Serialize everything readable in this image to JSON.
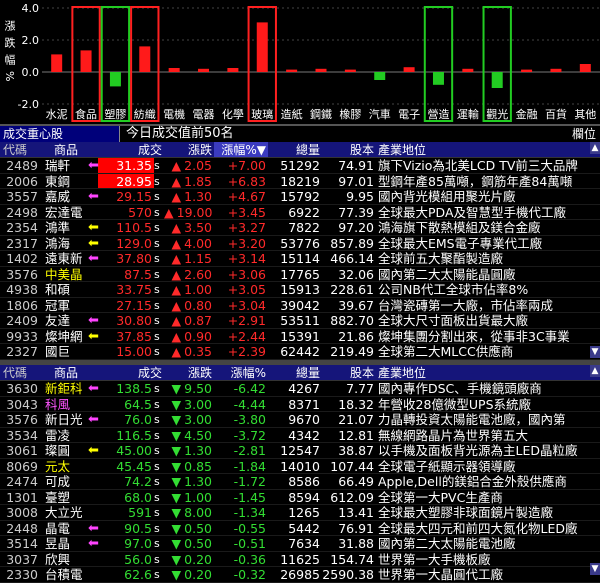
{
  "chart_data": {
    "type": "bar",
    "ylabel": "漲跌幅%",
    "ylim": [
      -2.0,
      4.0
    ],
    "yticks": [
      "4.0",
      "2.0",
      "0.0",
      "-2.0"
    ],
    "categories": [
      "水泥",
      "食品",
      "塑膠",
      "紡織",
      "電機",
      "電器",
      "化學",
      "玻璃",
      "造紙",
      "鋼鐵",
      "橡膠",
      "汽車",
      "電子",
      "營造",
      "運輸",
      "觀光",
      "金融",
      "百貨",
      "其他"
    ],
    "values": [
      1.1,
      1.35,
      -0.9,
      1.6,
      0.25,
      0.2,
      0.25,
      3.1,
      0.15,
      0.2,
      0.15,
      -0.5,
      0.3,
      -0.8,
      0.2,
      -1.0,
      0.15,
      0.2,
      0.5
    ],
    "boxed": {
      "食品": "red",
      "紡織": "red",
      "玻璃": "red",
      "塑膠": "green",
      "營造": "green",
      "觀光": "green"
    }
  },
  "title_bar": {
    "tab_label": "成交重心股",
    "title": "今日成交值前50名",
    "right_label": "欄位"
  },
  "header": {
    "code": "代碼",
    "name": "商品",
    "price": "成交",
    "change": "漲跌",
    "pct": "漲幅%",
    "vol": "總量",
    "cap": "股本",
    "desc": "產業地位"
  },
  "top_rows": [
    {
      "code": "2489",
      "name": "瑞軒",
      "price": "31.35",
      "dir": "up",
      "chg": "2.05",
      "pct": "+7.00",
      "vol": "51292",
      "cap": "74.91",
      "desc": "旗下Vizio為北美LCD TV前三大品牌",
      "hl": true,
      "mark": "arrow-mag"
    },
    {
      "code": "2006",
      "name": "東鋼",
      "price": "28.95",
      "dir": "up",
      "chg": "1.85",
      "pct": "+6.83",
      "vol": "18219",
      "cap": "97.01",
      "desc": "型鋼年產85萬噸，鋼筋年產84萬噸",
      "hl": true,
      "mark": ""
    },
    {
      "code": "3557",
      "name": "嘉威",
      "price": "29.15",
      "dir": "up",
      "chg": "1.30",
      "pct": "+4.67",
      "vol": "15792",
      "cap": "9.95",
      "desc": "國內背光模組用聚光片廠",
      "hl": false,
      "mark": "arrow-mag"
    },
    {
      "code": "2498",
      "name": "宏達電",
      "price": "570",
      "dir": "up",
      "chg": "19.00",
      "pct": "+3.45",
      "vol": "6922",
      "cap": "77.39",
      "desc": "全球最大PDA及智慧型手機代工廠",
      "hl": false,
      "mark": ""
    },
    {
      "code": "2354",
      "name": "鴻準",
      "price": "110.5",
      "dir": "up",
      "chg": "3.50",
      "pct": "+3.27",
      "vol": "7822",
      "cap": "97.20",
      "desc": "鴻海旗下散熱模組及鎂合金廠",
      "hl": false,
      "mark": "arrow-yel"
    },
    {
      "code": "2317",
      "name": "鴻海",
      "price": "129.0",
      "dir": "up",
      "chg": "4.00",
      "pct": "+3.20",
      "vol": "53776",
      "cap": "857.89",
      "desc": "全球最大EMS電子專業代工廠",
      "hl": false,
      "mark": "arrow-yel"
    },
    {
      "code": "1402",
      "name": "遠東新",
      "price": "37.80",
      "dir": "up",
      "chg": "1.15",
      "pct": "+3.14",
      "vol": "15114",
      "cap": "466.14",
      "desc": "全球前五大聚酯製造廠",
      "hl": false,
      "mark": "arrow-mag"
    },
    {
      "code": "3576",
      "name": "中美晶",
      "price": "87.5",
      "dir": "up",
      "chg": "2.60",
      "pct": "+3.06",
      "vol": "17765",
      "cap": "32.06",
      "desc": "國內第二大太陽能晶圓廠",
      "hl": false,
      "mark": "",
      "nameColor": "y"
    },
    {
      "code": "4938",
      "name": "和碩",
      "price": "33.75",
      "dir": "up",
      "chg": "1.00",
      "pct": "+3.05",
      "vol": "15913",
      "cap": "228.61",
      "desc": "公司NB代工全球市佔率8%",
      "hl": false,
      "mark": ""
    },
    {
      "code": "1806",
      "name": "冠軍",
      "price": "27.15",
      "dir": "up",
      "chg": "0.80",
      "pct": "+3.04",
      "vol": "39042",
      "cap": "39.67",
      "desc": "台灣瓷磚第一大廠，市佔率兩成",
      "hl": false,
      "mark": ""
    },
    {
      "code": "2409",
      "name": "友達",
      "price": "30.80",
      "dir": "up",
      "chg": "0.87",
      "pct": "+2.91",
      "vol": "53511",
      "cap": "882.70",
      "desc": "全球大尺寸面板出貨最大廠",
      "hl": false,
      "mark": "arrow-mag"
    },
    {
      "code": "9933",
      "name": "燦坤網",
      "price": "37.85",
      "dir": "up",
      "chg": "0.90",
      "pct": "+2.44",
      "vol": "15391",
      "cap": "21.86",
      "desc": "燦坤集團分割出來，從事非3C事業",
      "hl": false,
      "mark": "arrow-yel"
    },
    {
      "code": "2327",
      "name": "國巨",
      "price": "15.00",
      "dir": "up",
      "chg": "0.35",
      "pct": "+2.39",
      "vol": "62442",
      "cap": "219.49",
      "desc": "全球第二大MLCC供應商",
      "hl": false,
      "mark": ""
    }
  ],
  "bottom_rows": [
    {
      "code": "3630",
      "name": "新鉅科",
      "price": "138.5",
      "dir": "down",
      "chg": "9.50",
      "pct": "-6.42",
      "vol": "4267",
      "cap": "7.77",
      "desc": "國內專作DSC、手機鏡頭廠商",
      "mark": "arrow-mag",
      "nameColor": "y"
    },
    {
      "code": "3043",
      "name": "科風",
      "price": "64.5",
      "dir": "down",
      "chg": "3.00",
      "pct": "-4.44",
      "vol": "8371",
      "cap": "18.32",
      "desc": "年營收28億微型UPS系統廠",
      "mark": "",
      "nameColor": "mag"
    },
    {
      "code": "3576",
      "name": "新日光",
      "price": "76.0",
      "dir": "down",
      "chg": "3.00",
      "pct": "-3.80",
      "vol": "9670",
      "cap": "21.07",
      "desc": "力晶轉投資太陽能電池廠，國內第",
      "mark": "arrow-mag"
    },
    {
      "code": "3534",
      "name": "雷凌",
      "price": "116.5",
      "dir": "down",
      "chg": "4.50",
      "pct": "-3.72",
      "vol": "4342",
      "cap": "12.81",
      "desc": "無線網路晶片為世界第五大",
      "mark": ""
    },
    {
      "code": "3061",
      "name": "璨圓",
      "price": "45.00",
      "dir": "down",
      "chg": "1.30",
      "pct": "-2.81",
      "vol": "12547",
      "cap": "38.87",
      "desc": "以手機及面板背光源為主LED晶粒廠",
      "mark": "arrow-yel"
    },
    {
      "code": "8069",
      "name": "元太",
      "price": "45.45",
      "dir": "down",
      "chg": "0.85",
      "pct": "-1.84",
      "vol": "14010",
      "cap": "107.44",
      "desc": "全球電子紙顯示器領導廠",
      "mark": "",
      "nameColor": "y"
    },
    {
      "code": "2474",
      "name": "可成",
      "price": "74.2",
      "dir": "down",
      "chg": "1.30",
      "pct": "-1.72",
      "vol": "8586",
      "cap": "66.49",
      "desc": "Apple,Dell的鎂鋁合金外殼供應商",
      "mark": ""
    },
    {
      "code": "1301",
      "name": "臺塑",
      "price": "68.0",
      "dir": "down",
      "chg": "1.00",
      "pct": "-1.45",
      "vol": "8594",
      "cap": "612.09",
      "desc": "全球第一大PVC生產商",
      "mark": ""
    },
    {
      "code": "3008",
      "name": "大立光",
      "price": "591",
      "dir": "down",
      "chg": "8.00",
      "pct": "-1.34",
      "vol": "1265",
      "cap": "13.41",
      "desc": "全球最大塑膠非球面鏡片製造廠",
      "mark": ""
    },
    {
      "code": "2448",
      "name": "晶電",
      "price": "90.5",
      "dir": "down",
      "chg": "0.50",
      "pct": "-0.55",
      "vol": "5442",
      "cap": "76.91",
      "desc": "全球最大四元和前四大氮化物LED廠",
      "mark": "arrow-mag"
    },
    {
      "code": "3514",
      "name": "昱晶",
      "price": "97.0",
      "dir": "down",
      "chg": "0.50",
      "pct": "-0.51",
      "vol": "7634",
      "cap": "31.88",
      "desc": "國內第二大太陽能電池廠",
      "mark": "arrow-mag"
    },
    {
      "code": "3037",
      "name": "欣興",
      "price": "56.0",
      "dir": "down",
      "chg": "0.20",
      "pct": "-0.36",
      "vol": "11625",
      "cap": "154.74",
      "desc": "世界第一大手機板廠",
      "mark": ""
    },
    {
      "code": "2330",
      "name": "台積電",
      "price": "62.6",
      "dir": "down",
      "chg": "0.20",
      "pct": "-0.32",
      "vol": "26985",
      "cap": "2590.38",
      "desc": "世界第一大晶圓代工廠",
      "mark": ""
    }
  ]
}
